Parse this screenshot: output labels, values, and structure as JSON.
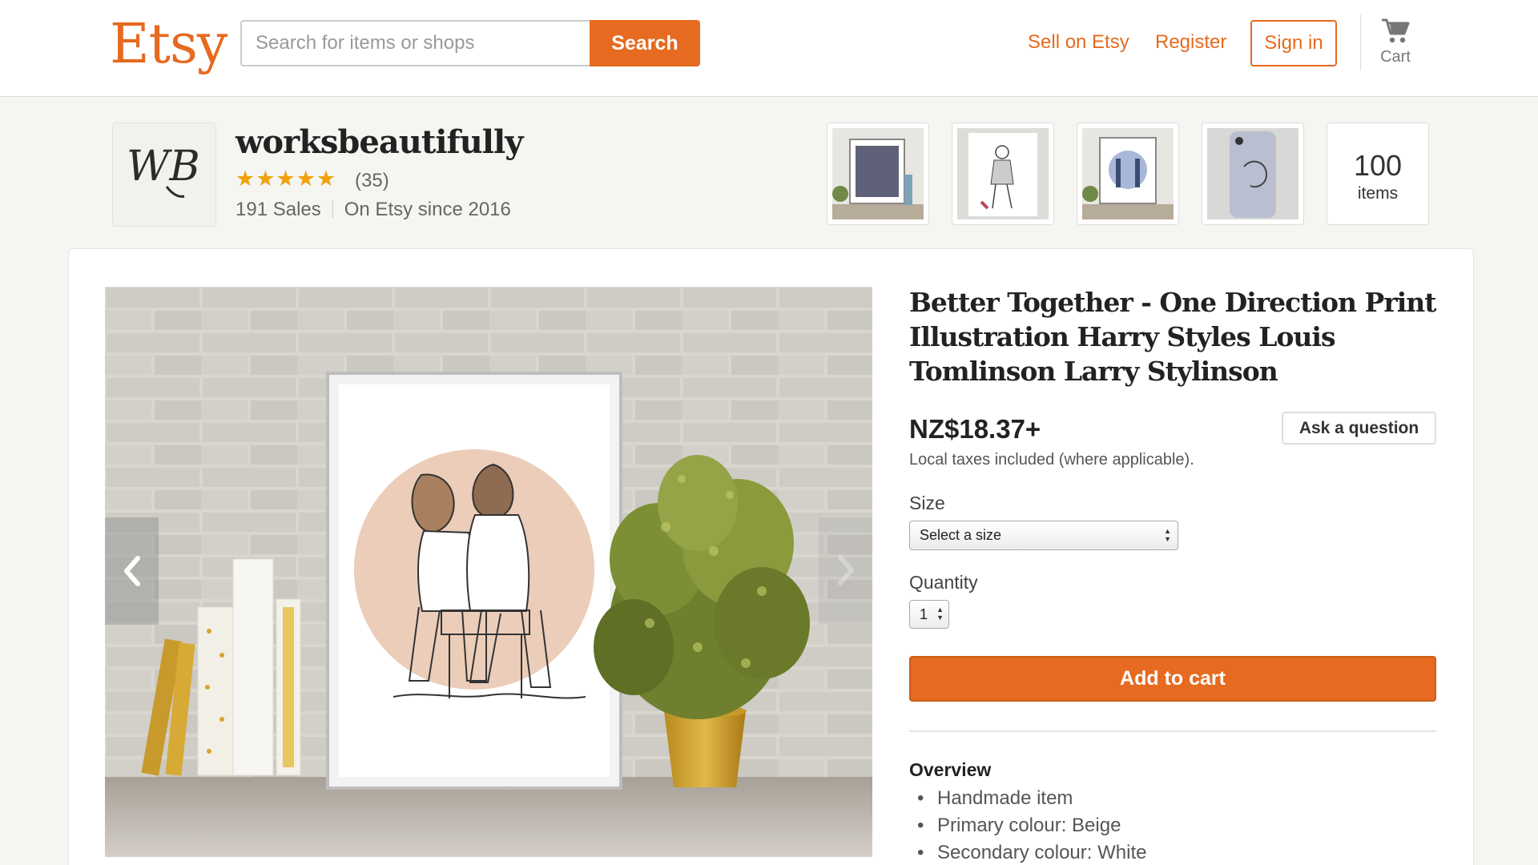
{
  "header": {
    "logo": "Etsy",
    "search": {
      "placeholder": "Search for items or shops",
      "value": "",
      "button_label": "Search"
    },
    "nav": {
      "sell_label": "Sell on Etsy",
      "register_label": "Register",
      "signin_label": "Sign in"
    },
    "cart_label": "Cart"
  },
  "shop": {
    "avatar_text": "WB",
    "name": "worksbeautifully",
    "stars": "★★★★★",
    "review_count": "(35)",
    "sales": "191 Sales",
    "since": "On Etsy since 2016",
    "items_count": "100",
    "items_label": "items"
  },
  "listing": {
    "title": "Better Together - One Direction Print Illustration Harry Styles Louis Tomlinson Larry Stylinson",
    "price": "NZ$18.37+",
    "tax_note": "Local taxes included (where applicable).",
    "ask_label": "Ask a question",
    "size_label": "Size",
    "size_selected": "Select a size",
    "quantity_label": "Quantity",
    "quantity_selected": "1",
    "add_to_cart_label": "Add to cart",
    "overview_title": "Overview",
    "overview_items": [
      "Handmade item",
      "Primary colour: Beige",
      "Secondary colour: White"
    ]
  },
  "colors": {
    "accent": "#e66a1f",
    "star": "#f1a10c",
    "background": "#f5f5f1"
  },
  "icons": [
    "cart-icon",
    "chevron-left-icon",
    "chevron-right-icon",
    "star-icon"
  ]
}
